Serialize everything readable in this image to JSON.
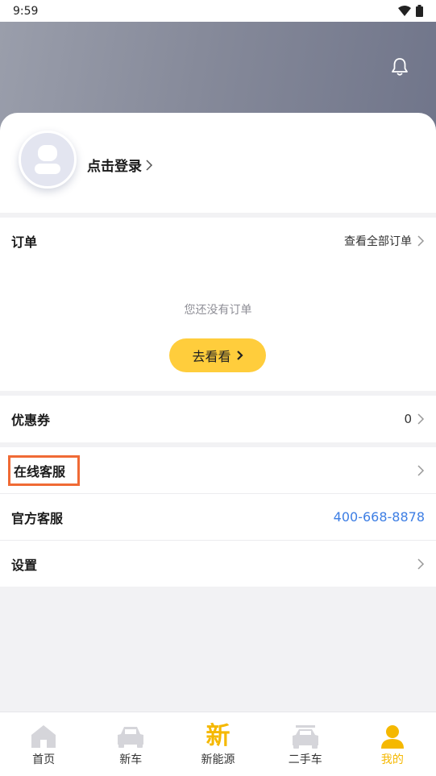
{
  "status": {
    "time": "9:59"
  },
  "profile": {
    "login_label": "点击登录"
  },
  "orders": {
    "title": "订单",
    "view_all": "查看全部订单",
    "empty_text": "您还没有订单",
    "go_button": "去看看"
  },
  "coupon": {
    "title": "优惠券",
    "count": "0"
  },
  "services": {
    "online": "在线客服",
    "official": "官方客服",
    "phone": "400-668-8878",
    "settings": "设置"
  },
  "tabs": [
    {
      "label": "首页",
      "icon": "home-icon"
    },
    {
      "label": "新车",
      "icon": "car-icon"
    },
    {
      "label": "新能源",
      "icon": "new-energy-icon",
      "glyph": "新"
    },
    {
      "label": "二手车",
      "icon": "used-car-icon"
    },
    {
      "label": "我的",
      "icon": "profile-icon"
    }
  ],
  "colors": {
    "accent": "#ffcd3c",
    "active_tab": "#f5b800",
    "phone_link": "#3d7ee4",
    "highlight": "#f06a35"
  }
}
